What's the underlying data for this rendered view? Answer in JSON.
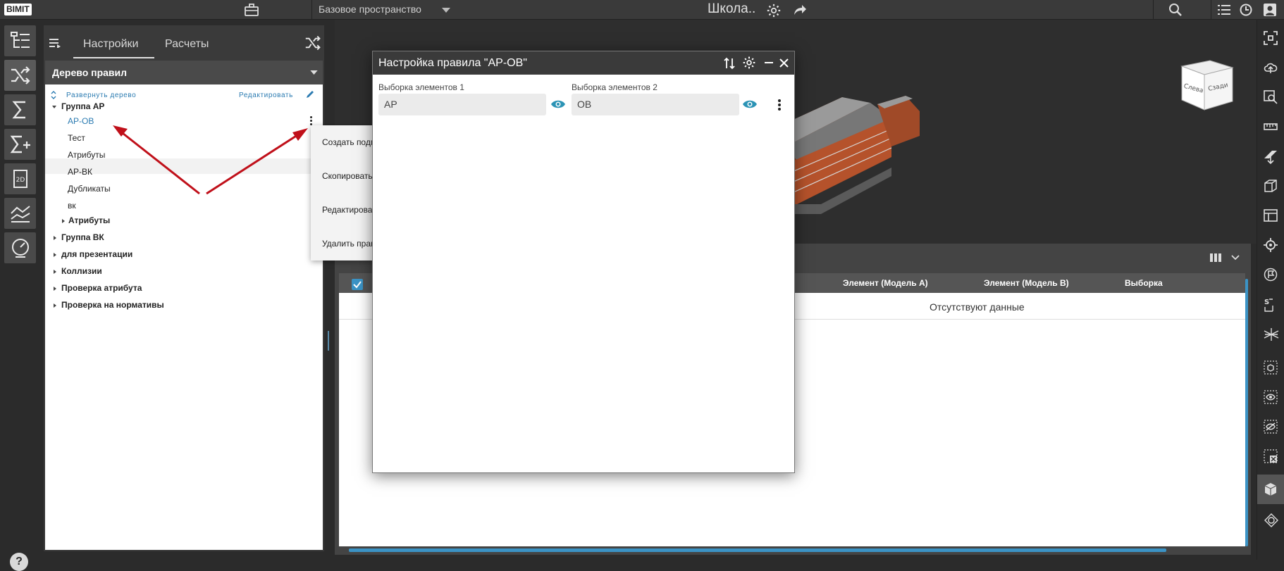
{
  "app": {
    "logo": "BIMIT",
    "workspace": "Базовое пространство",
    "project": "Школа.."
  },
  "left_panel": {
    "tabs": [
      {
        "label": "Настройки"
      },
      {
        "label": "Расчеты"
      }
    ],
    "tree_header": "Дерево правил",
    "expand_label": "Развернуть дерево",
    "edit_label": "Редактировать",
    "tree": {
      "group_ar": "Группа АР",
      "children": [
        "АР-ОВ",
        "Тест",
        "Атрибуты",
        "АР-ВК",
        "Дубликаты",
        "вк"
      ],
      "sub_attr": "Атрибуты",
      "groups": [
        "Группа ВК",
        "для презентации",
        "Коллизии",
        "Проверка атрибута",
        "Проверка на нормативы"
      ]
    }
  },
  "context_menu": {
    "items": [
      "Создать подправило",
      "Скопировать правило",
      "Редактировать правило",
      "Удалить правило"
    ]
  },
  "dialog": {
    "title": "Настройка правила \"АР-ОВ\"",
    "selection1_label": "Выборка элементов 1",
    "selection1_value": "АР",
    "selection2_label": "Выборка элементов 2",
    "selection2_value": "ОВ"
  },
  "results_table": {
    "columns": [
      "Элемент (Модель А)",
      "Элемент (Модель B)",
      "Выборка"
    ],
    "empty_text": "Отсутствуют данные"
  },
  "navcube": {
    "left": "Слева",
    "front": "Сзади"
  },
  "colors": {
    "accent": "#3b93c5",
    "link": "#2b7bb1",
    "arrow": "#c0101a"
  }
}
